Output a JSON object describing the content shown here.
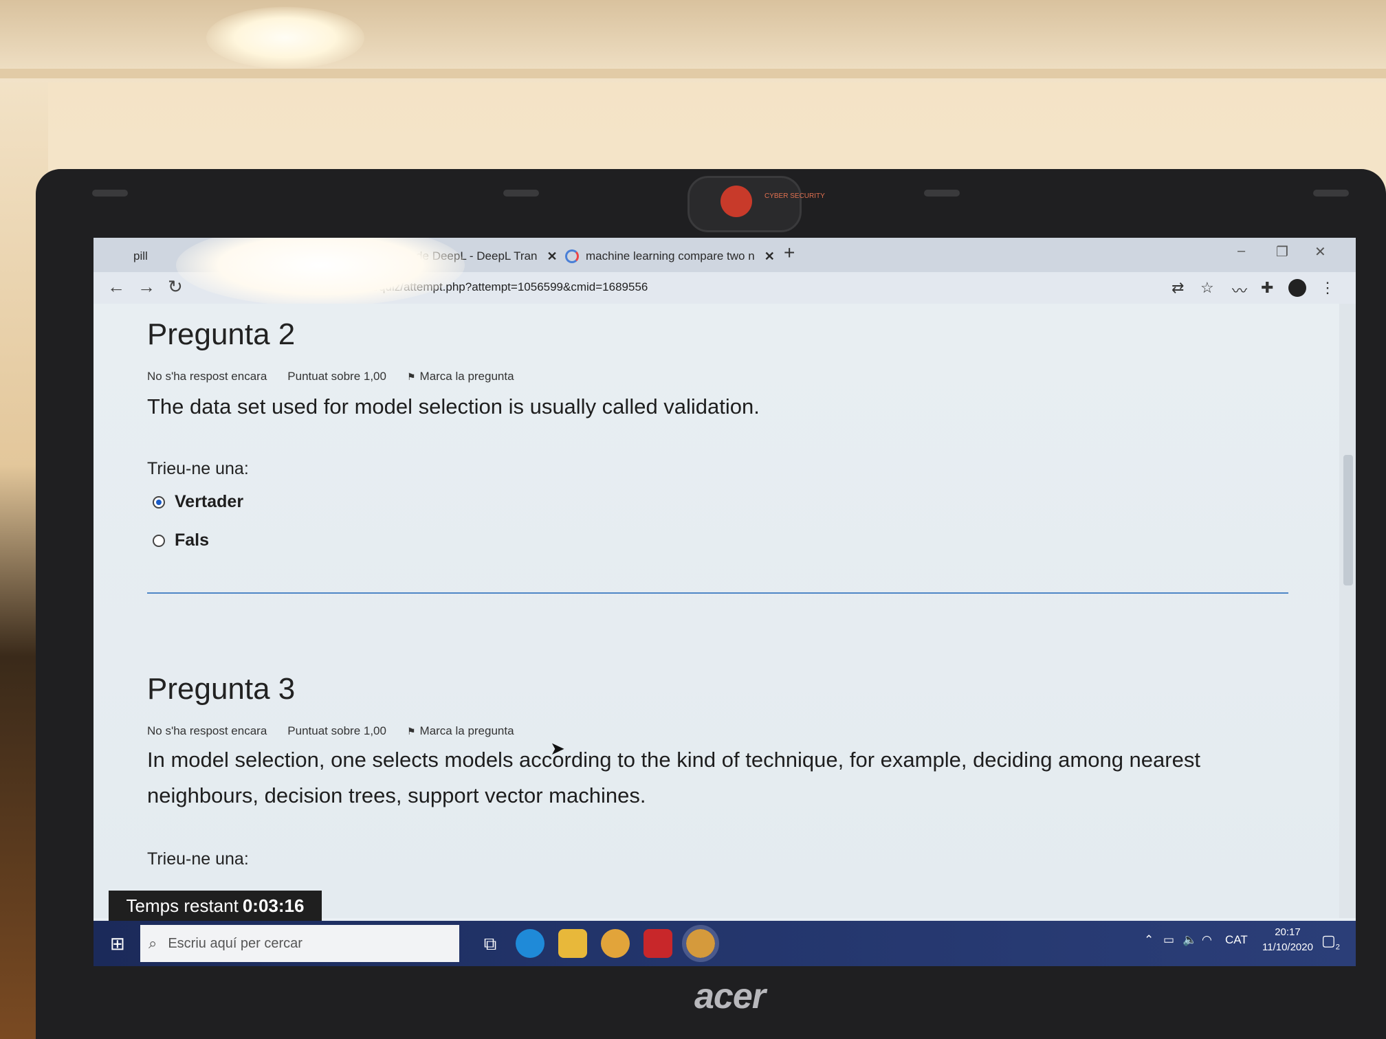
{
  "browser": {
    "tabs": [
      {
        "label": "pill"
      },
      {
        "label": "ctor de DeepL - DeepL Tran"
      },
      {
        "label": "machine learning compare two n"
      }
    ],
    "new_tab_symbol": "+",
    "window_controls": {
      "minimize": "–",
      "restore": "❐",
      "close": "✕"
    },
    "url": "b.edu/mod/quiz/attempt.php?attempt=1056599&cmid=1689556"
  },
  "quiz": {
    "questions": [
      {
        "title": "Pregunta 2",
        "status": "No s'ha respost encara",
        "score": "Puntuat sobre 1,00",
        "flag": "Marca la pregunta",
        "text": "The data set used for model selection is usually called validation.",
        "choose_label": "Trieu-ne una:",
        "options": [
          {
            "label": "Vertader",
            "selected": true
          },
          {
            "label": "Fals",
            "selected": false
          }
        ]
      },
      {
        "title": "Pregunta 3",
        "status": "No s'ha respost encara",
        "score": "Puntuat sobre 1,00",
        "flag": "Marca la pregunta",
        "text": "In model selection, one selects models according to the kind of technique, for example, deciding among nearest neighbours, decision trees, support vector machines.",
        "choose_label": "Trieu-ne una:"
      }
    ],
    "timer_label": "Temps restant",
    "timer_value": "0:03:16"
  },
  "taskbar": {
    "search_placeholder": "Escriu aquí per cercar",
    "language": "CAT",
    "time": "20:17",
    "date": "11/10/2020",
    "notification_count": "2"
  },
  "laptop": {
    "brand": "acer",
    "sticker_text": "CYBER SECURITY"
  },
  "colors": {
    "accent": "#1a5cc8",
    "separator": "#4e86c6",
    "taskbar": "#22346a"
  }
}
